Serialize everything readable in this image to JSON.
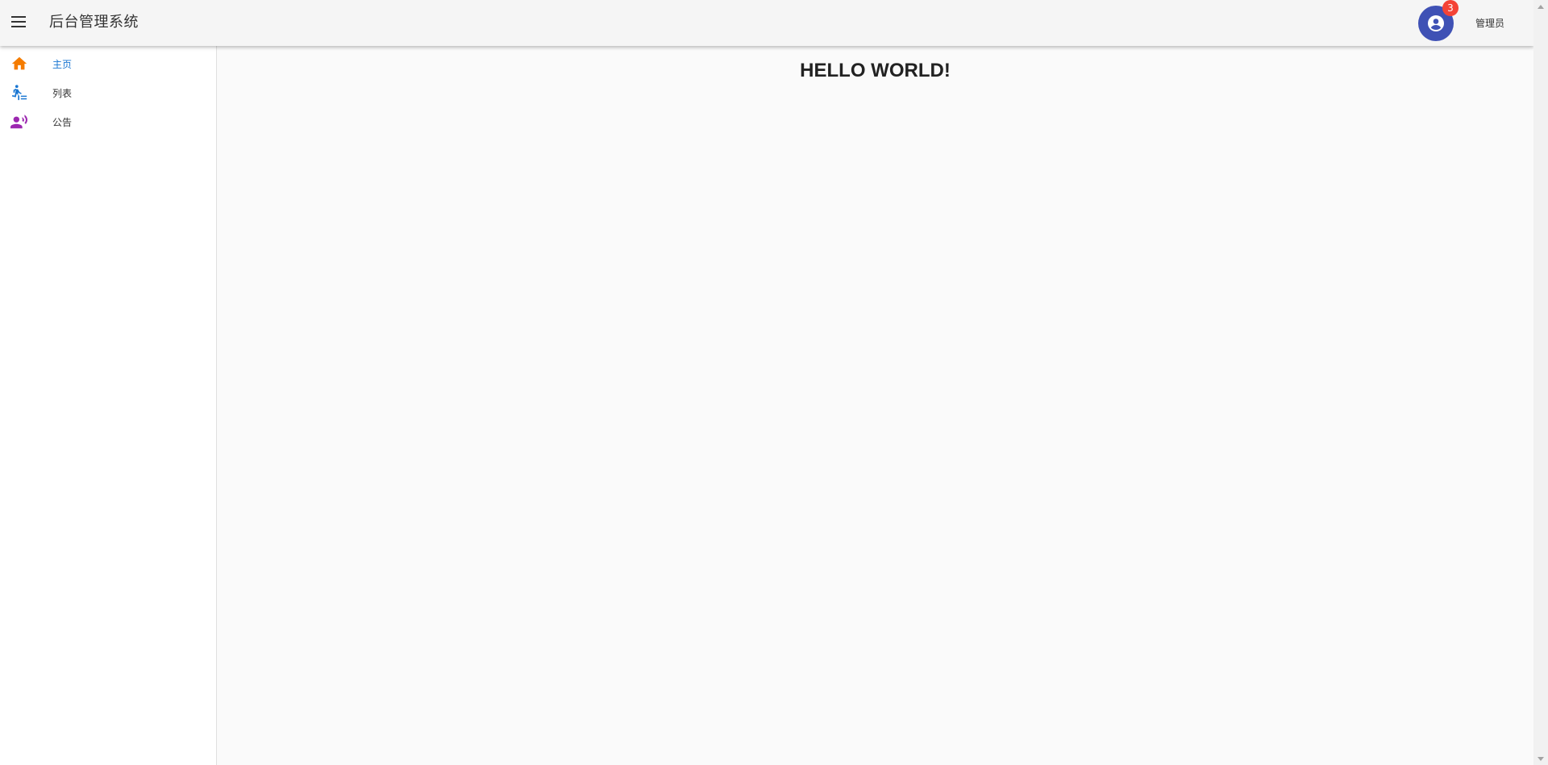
{
  "header": {
    "title": "后台管理系统",
    "user_name": "管理员",
    "notification_count": "3",
    "avatar_color": "#3f51b5",
    "badge_color": "#f44336"
  },
  "sidebar": {
    "items": [
      {
        "label": "主页",
        "icon": "home-icon",
        "icon_color": "#f57c00",
        "active": true
      },
      {
        "label": "列表",
        "icon": "walk-list-icon",
        "icon_color": "#1976d2",
        "active": false
      },
      {
        "label": "公告",
        "icon": "announcement-person-icon",
        "icon_color": "#9c27b0",
        "active": false
      }
    ]
  },
  "main": {
    "heading": "HELLO WORLD!"
  }
}
